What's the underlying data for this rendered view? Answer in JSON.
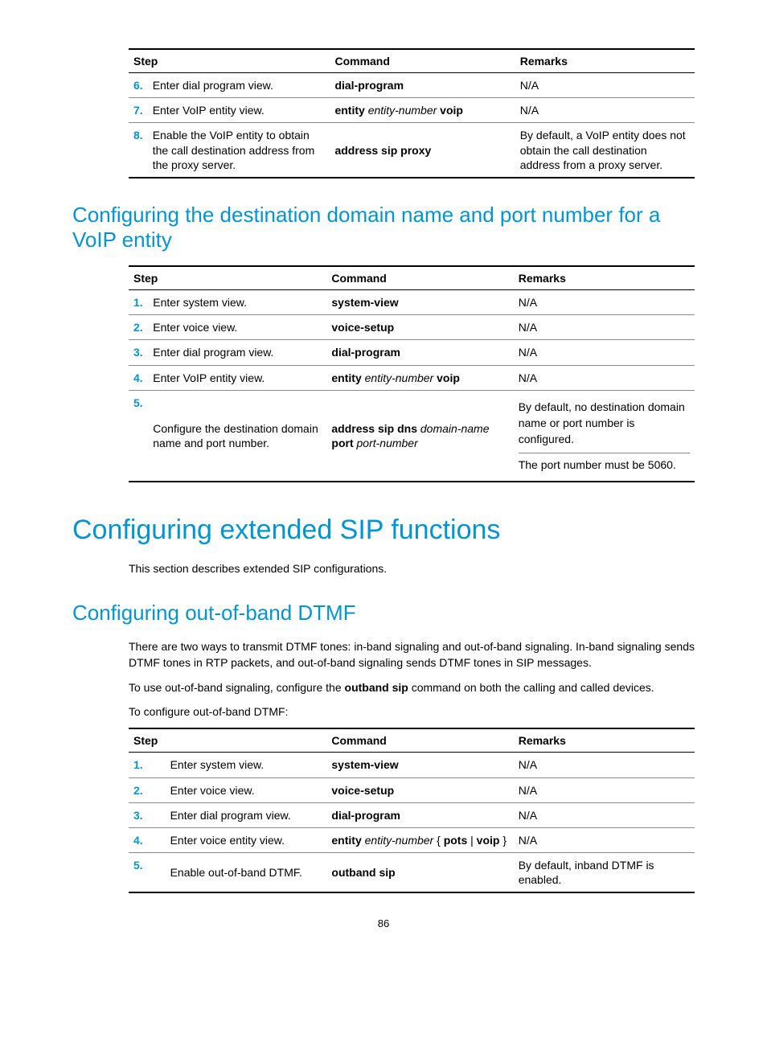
{
  "table1": {
    "headers": {
      "step": "Step",
      "command": "Command",
      "remarks": "Remarks"
    },
    "rows": [
      {
        "num": "6.",
        "step": "Enter dial program view.",
        "cmd_bold1": "dial-program",
        "remarks": "N/A"
      },
      {
        "num": "7.",
        "step": "Enter VoIP entity view.",
        "cmd_bold1": "entity",
        "cmd_arg1": "entity-number",
        "cmd_bold2": "voip",
        "remarks": "N/A"
      },
      {
        "num": "8.",
        "step": "Enable the VoIP entity to obtain the call destination address from the proxy server.",
        "cmd_bold1": "address sip proxy",
        "remarks": "By default, a VoIP entity does not obtain the call destination address from a proxy server."
      }
    ]
  },
  "heading1": "Configuring the destination domain name and port number for a VoIP entity",
  "table2": {
    "headers": {
      "step": "Step",
      "command": "Command",
      "remarks": "Remarks"
    },
    "rows": [
      {
        "num": "1.",
        "step": "Enter system view.",
        "cmd_bold1": "system-view",
        "remarks": "N/A"
      },
      {
        "num": "2.",
        "step": "Enter voice view.",
        "cmd_bold1": "voice-setup",
        "remarks": "N/A"
      },
      {
        "num": "3.",
        "step": "Enter dial program view.",
        "cmd_bold1": "dial-program",
        "remarks": "N/A"
      },
      {
        "num": "4.",
        "step": "Enter VoIP entity view.",
        "cmd_bold1": "entity",
        "cmd_arg1": "entity-number",
        "cmd_bold2": "voip",
        "remarks": "N/A"
      },
      {
        "num": "5.",
        "step": "Configure the destination domain name and port number.",
        "cmd_bold1": "address sip dns",
        "cmd_arg1": "domain-name",
        "cmd_bold2": "port",
        "cmd_arg2": "port-number",
        "remarks1": "By default, no destination domain name or port number is configured.",
        "remarks2": "The port number must be 5060."
      }
    ]
  },
  "heading2": "Configuring extended SIP functions",
  "para1": "This section describes extended SIP configurations.",
  "heading3": "Configuring out-of-band DTMF",
  "para2": "There are two ways to transmit DTMF tones: in-band signaling and out-of-band signaling. In-band signaling sends DTMF tones in RTP packets, and out-of-band signaling sends DTMF tones in SIP messages.",
  "para3_a": "To use out-of-band signaling, configure the ",
  "para3_b": "outband sip",
  "para3_c": " command on both the calling and called devices.",
  "para4": "To configure out-of-band DTMF:",
  "table3": {
    "headers": {
      "step": "Step",
      "command": "Command",
      "remarks": "Remarks"
    },
    "rows": [
      {
        "num": "1.",
        "step": "Enter system view.",
        "cmd_bold1": "system-view",
        "remarks": "N/A"
      },
      {
        "num": "2.",
        "step": "Enter voice view.",
        "cmd_bold1": "voice-setup",
        "remarks": "N/A"
      },
      {
        "num": "3.",
        "step": "Enter dial program view.",
        "cmd_bold1": "dial-program",
        "remarks": "N/A"
      },
      {
        "num": "4.",
        "step": "Enter voice entity view.",
        "cmd_bold1a": "entity",
        "cmd_arg1": "entity-number",
        "cmd_plain1": " { ",
        "cmd_bold2": "pots",
        "cmd_plain2": " | ",
        "cmd_bold3": "voip",
        "cmd_plain3": " }",
        "remarks": "N/A"
      },
      {
        "num": "5.",
        "step": "Enable out-of-band DTMF.",
        "cmd_bold1": "outband sip",
        "remarks": "By default, inband DTMF is enabled."
      }
    ]
  },
  "page_number": "86"
}
